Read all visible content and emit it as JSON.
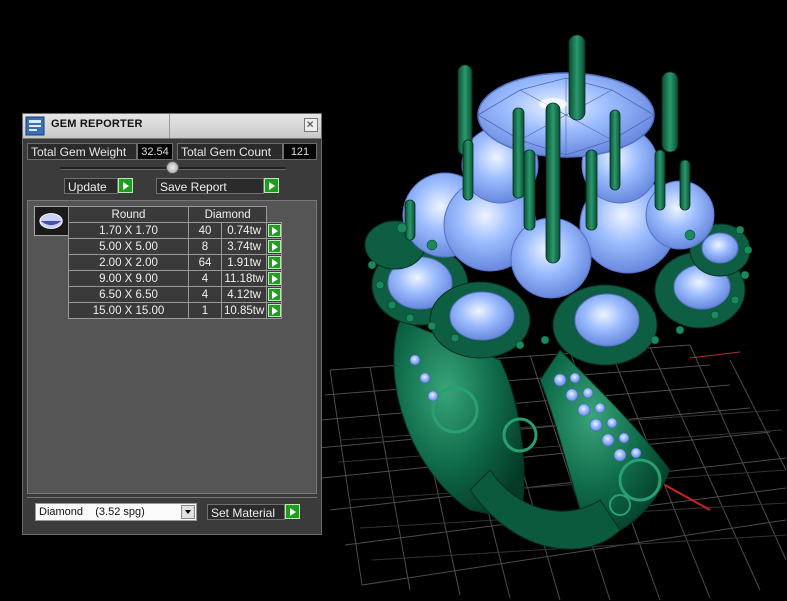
{
  "panel": {
    "title": "GEM REPORTER",
    "total_weight_label": "Total Gem Weight",
    "total_weight_value": "32.54",
    "total_count_label": "Total Gem Count",
    "total_count_value": "121",
    "update_label": "Update",
    "save_report_label": "Save Report",
    "table": {
      "header_shape": "Round",
      "header_material": "Diamond",
      "rows": [
        {
          "size": "1.70 X 1.70",
          "count": "40",
          "weight": "0.74tw"
        },
        {
          "size": "5.00 X 5.00",
          "count": "8",
          "weight": "3.74tw"
        },
        {
          "size": "2.00 X 2.00",
          "count": "64",
          "weight": "1.91tw"
        },
        {
          "size": "9.00 X 9.00",
          "count": "4",
          "weight": "11.18tw"
        },
        {
          "size": "6.50 X 6.50",
          "count": "4",
          "weight": "4.12tw"
        },
        {
          "size": "15.00 X 15.00",
          "count": "1",
          "weight": "10.85tw"
        }
      ]
    },
    "material_select_value": "Diamond    (3.52 spg)",
    "set_material_label": "Set Material"
  },
  "icons": [
    "app-icon",
    "close-icon",
    "slider-knob",
    "arrow-right-icon",
    "gem-thumbnail",
    "chevron-down-icon"
  ],
  "colors": {
    "panel_bg": "#3b3b3b",
    "accent_green": "#1e9d1e",
    "metal_green": "#0e6b4c",
    "gem_blue": "#8cb4ff",
    "grid": "#5a5a5a",
    "axis_red": "#cc2222"
  }
}
